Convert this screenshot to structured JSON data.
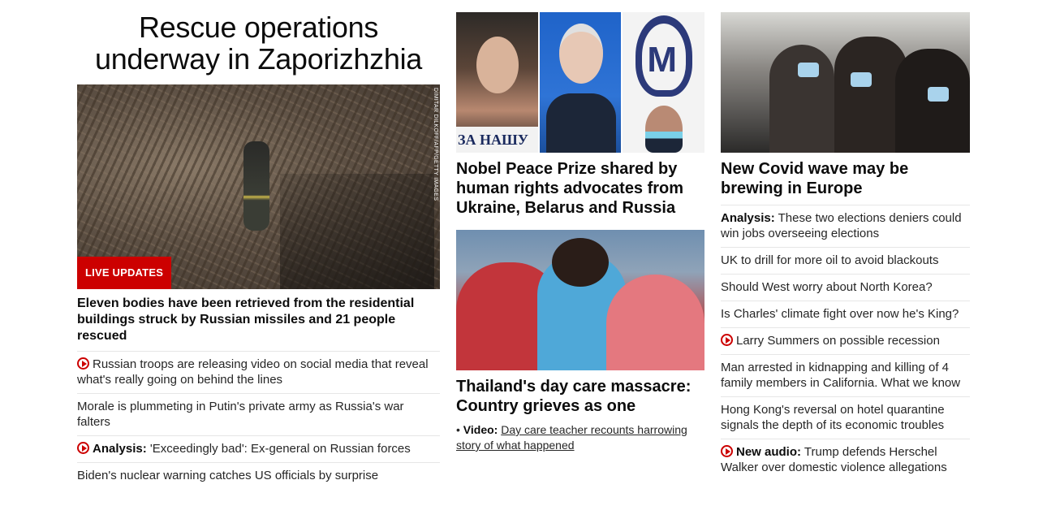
{
  "col1": {
    "title": "Rescue operations underway in Zaporizhzhia",
    "photo_credit": "DIMITAR DILKOFF/AFP/GETTY IMAGES",
    "badge": "LIVE UPDATES",
    "headline": "Eleven bodies have been retrieved from the residential buildings struck by Russian missiles and 21 people rescued",
    "items": [
      {
        "text": "Russian troops are releasing video on social media that reveal what's really going on behind the lines"
      },
      {
        "text": "Morale is plummeting in Putin's private army as Russia's war falters"
      },
      {
        "label": "Analysis:",
        "text": "'Exceedingly bad': Ex-general on Russian forces"
      },
      {
        "text": "Biden's nuclear warning catches US officials by surprise"
      }
    ]
  },
  "col2": {
    "sign_text": "ЗА НАШУ",
    "story1_headline": "Nobel Peace Prize shared by human rights advocates from Ukraine, Belarus and Russia",
    "story2_headline": "Thailand's day care massacre: Country grieves as one",
    "sub": {
      "bullet": "•",
      "label": "Video:",
      "text": "Day care teacher recounts harrowing story of what happened"
    }
  },
  "col3": {
    "headline": "New Covid wave may be brewing in Europe",
    "items": [
      {
        "label": "Analysis:",
        "text": "These two elections deniers could win jobs overseeing elections"
      },
      {
        "text": "UK to drill for more oil to avoid blackouts"
      },
      {
        "text": "Should West worry about North Korea?"
      },
      {
        "text": "Is Charles' climate fight over now he's King?"
      },
      {
        "text": "Larry Summers on possible recession"
      },
      {
        "text": "Man arrested in kidnapping and killing of 4 family members in California. What we know"
      },
      {
        "text": "Hong Kong's reversal on hotel quarantine signals the depth of its economic troubles"
      },
      {
        "label": "New audio:",
        "text": "Trump defends Herschel Walker over domestic violence allegations"
      }
    ]
  },
  "colors": {
    "accent": "#cc0000",
    "divider": "#e6e6e6",
    "text": "#0c0c0c"
  },
  "icons": {
    "video": "play-circle-icon"
  }
}
